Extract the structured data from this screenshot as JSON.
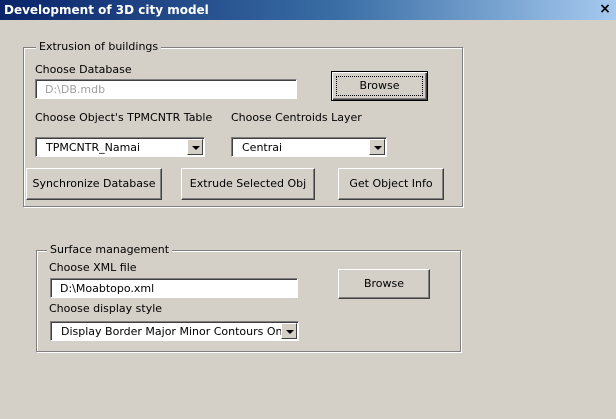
{
  "window": {
    "title": "Development of 3D city model",
    "close_glyph": "×"
  },
  "extrusion": {
    "legend": "Extrusion of buildings",
    "choose_db_label": "Choose Database",
    "db_value": "D:\\DB.mdb",
    "browse_label": "Browse",
    "tpmcntr_label": "Choose Object's TPMCNTR Table",
    "tpmcntr_value": "TPMCNTR_Namai",
    "centroids_label": "Choose Centroids Layer",
    "centroids_value": "Centrai",
    "sync_label": "Synchronize Database",
    "extrude_label": "Extrude Selected Obj",
    "info_label": "Get Object Info"
  },
  "surface": {
    "legend": "Surface management",
    "xml_label": "Choose XML file",
    "xml_value": "D:\\Moabtopo.xml",
    "browse_label": "Browse",
    "style_label": "Choose display style",
    "style_value": "Display Border Major Minor Contours Only"
  }
}
